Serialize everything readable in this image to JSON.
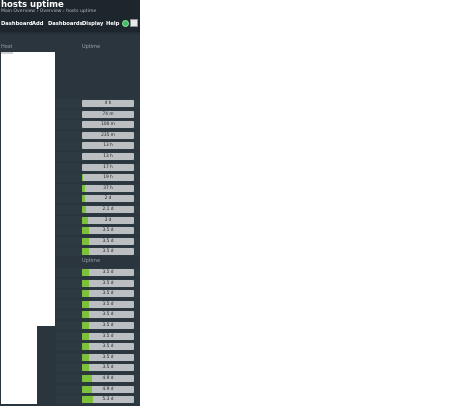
{
  "header": {
    "title": "hosts uptime",
    "breadcrumb": "Main Overview › Overview › hosts uptime"
  },
  "menu": [
    {
      "label": "Dashboard"
    },
    {
      "label": "Add"
    },
    {
      "label": "Dashboards"
    },
    {
      "label": "Display"
    },
    {
      "label": "Help"
    }
  ],
  "icons": {
    "status": "status-dot-icon",
    "notes": "notes-icon"
  },
  "colors": {
    "ok": "#3fbf5f",
    "gauge_fill": "#7dc13a",
    "gauge_bg": "#bcbfc2"
  },
  "columns": {
    "host": "Host",
    "uptime": "Uptime"
  },
  "group1": [
    {
      "uptime": "4 h",
      "fraction": 0.0
    },
    {
      "uptime": "74 m",
      "fraction": 0.0
    },
    {
      "uptime": "100 m",
      "fraction": 0.0
    },
    {
      "uptime": "235 m",
      "fraction": 0.0
    },
    {
      "uptime": "13 h",
      "fraction": 0.0
    },
    {
      "uptime": "13 h",
      "fraction": 0.0
    },
    {
      "uptime": "17 h",
      "fraction": 0.0
    },
    {
      "uptime": "19 h",
      "fraction": 0.02
    },
    {
      "uptime": "37 h",
      "fraction": 0.05
    },
    {
      "uptime": "2 d",
      "fraction": 0.06
    },
    {
      "uptime": "2.1 d",
      "fraction": 0.07
    },
    {
      "uptime": "3 d",
      "fraction": 0.12
    },
    {
      "uptime": "3.5 d",
      "fraction": 0.14
    },
    {
      "uptime": "3.5 d",
      "fraction": 0.14
    },
    {
      "uptime": "3.5 d",
      "fraction": 0.14
    }
  ],
  "group2_header": "Uptime",
  "group2": [
    {
      "uptime": "3.5 d",
      "fraction": 0.14
    },
    {
      "uptime": "3.5 d",
      "fraction": 0.14
    },
    {
      "uptime": "3.5 d",
      "fraction": 0.14
    },
    {
      "uptime": "3.5 d",
      "fraction": 0.14
    },
    {
      "uptime": "3.5 d",
      "fraction": 0.14
    },
    {
      "uptime": "3.5 d",
      "fraction": 0.14
    },
    {
      "uptime": "3.5 d",
      "fraction": 0.14
    },
    {
      "uptime": "3.5 d",
      "fraction": 0.14
    },
    {
      "uptime": "3.5 d",
      "fraction": 0.14
    },
    {
      "uptime": "3.5 d",
      "fraction": 0.14
    },
    {
      "uptime": "4.9 d",
      "fraction": 0.2
    },
    {
      "uptime": "4.9 d",
      "fraction": 0.2
    },
    {
      "uptime": "5.3 d",
      "fraction": 0.22
    }
  ]
}
